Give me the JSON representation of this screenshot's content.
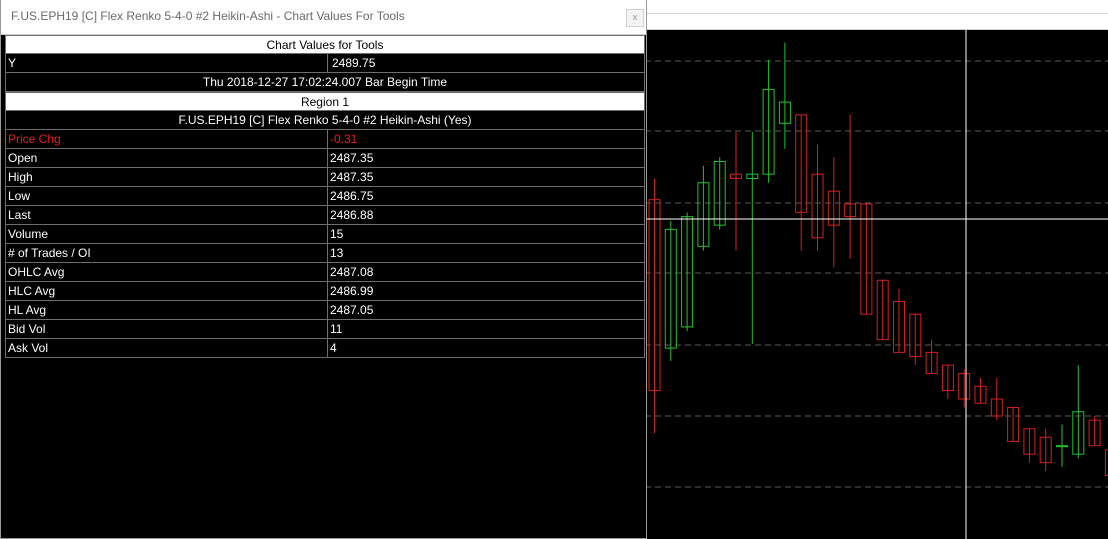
{
  "window": {
    "title": "F.US.EPH19 [C]  Flex Renko 5-4-0  #2 Heikin-Ashi - Chart Values For Tools",
    "close_glyph": "x"
  },
  "table": {
    "header": "Chart Values for Tools",
    "y_row": {
      "label": "Y",
      "value": "2489.75"
    },
    "bar_time": "Thu 2018-12-27  17:02:24.007  Bar Begin Time",
    "region": "Region 1",
    "study": "F.US.EPH19 [C]  Flex Renko 5-4-0  #2 Heikin-Ashi (Yes)",
    "rows": [
      {
        "label": "Price Chg",
        "value": "-0.31",
        "color": "#e81e1e"
      },
      {
        "label": "Open",
        "value": "2487.35"
      },
      {
        "label": "High",
        "value": "2487.35"
      },
      {
        "label": "Low",
        "value": "2486.75"
      },
      {
        "label": "Last",
        "value": "2486.88"
      },
      {
        "label": "Volume",
        "value": "15"
      },
      {
        "label": "# of Trades / OI",
        "value": "13"
      },
      {
        "label": "OHLC Avg",
        "value": "2487.08"
      },
      {
        "label": "HLC Avg",
        "value": "2486.99"
      },
      {
        "label": "HL Avg",
        "value": "2487.05"
      },
      {
        "label": "Bid Vol",
        "value": "11"
      },
      {
        "label": "Ask Vol",
        "value": "4"
      }
    ]
  },
  "colors": {
    "up": "#22c22a",
    "down": "#d42020",
    "crosshair": "#ffffff",
    "grid": "#5a5a5a",
    "background": "#000000"
  },
  "chart": {
    "candles": [
      {
        "dir": "down",
        "open": 2491.0,
        "close": 2486.5,
        "high": 2491.5,
        "low": 2485.5
      },
      {
        "dir": "up",
        "open": 2487.5,
        "close": 2490.3,
        "high": 2490.5,
        "low": 2487.2
      },
      {
        "dir": "up",
        "open": 2488.0,
        "close": 2490.6,
        "high": 2490.7,
        "low": 2487.9
      },
      {
        "dir": "up",
        "open": 2489.9,
        "close": 2491.4,
        "high": 2491.8,
        "low": 2489.8
      },
      {
        "dir": "up",
        "open": 2490.4,
        "close": 2491.9,
        "high": 2492.0,
        "low": 2490.3
      },
      {
        "dir": "down",
        "open": 2491.6,
        "close": 2491.5,
        "high": 2492.6,
        "low": 2489.8
      },
      {
        "dir": "up",
        "open": 2491.5,
        "close": 2491.6,
        "high": 2492.6,
        "low": 2487.6
      },
      {
        "dir": "up",
        "open": 2491.6,
        "close": 2493.6,
        "high": 2494.3,
        "low": 2491.4
      },
      {
        "dir": "up",
        "open": 2492.8,
        "close": 2493.3,
        "high": 2494.7,
        "low": 2492.2
      },
      {
        "dir": "down",
        "open": 2493.0,
        "close": 2490.7,
        "high": 2493.0,
        "low": 2489.8
      },
      {
        "dir": "down",
        "open": 2491.6,
        "close": 2490.1,
        "high": 2492.3,
        "low": 2489.8
      },
      {
        "dir": "down",
        "open": 2491.2,
        "close": 2490.4,
        "high": 2492.0,
        "low": 2489.4
      },
      {
        "dir": "down",
        "open": 2490.9,
        "close": 2490.6,
        "high": 2493.0,
        "low": 2489.6
      },
      {
        "dir": "down",
        "open": 2490.9,
        "close": 2488.3,
        "high": 2490.9,
        "low": 2488.3
      },
      {
        "dir": "down",
        "open": 2489.1,
        "close": 2487.7,
        "high": 2489.1,
        "low": 2487.7
      },
      {
        "dir": "down",
        "open": 2488.6,
        "close": 2487.4,
        "high": 2488.9,
        "low": 2487.4
      },
      {
        "dir": "down",
        "open": 2488.3,
        "close": 2487.3,
        "high": 2488.3,
        "low": 2487.1
      },
      {
        "dir": "down",
        "open": 2487.4,
        "close": 2486.9,
        "high": 2487.7,
        "low": 2486.9
      },
      {
        "dir": "down",
        "open": 2487.1,
        "close": 2486.5,
        "high": 2487.1,
        "low": 2486.3
      },
      {
        "dir": "down",
        "open": 2486.9,
        "close": 2486.3,
        "high": 2487.0,
        "low": 2486.1
      },
      {
        "dir": "down",
        "open": 2486.6,
        "close": 2486.2,
        "high": 2486.8,
        "low": 2486.2
      },
      {
        "dir": "down",
        "open": 2486.3,
        "close": 2485.9,
        "high": 2486.8,
        "low": 2485.8
      },
      {
        "dir": "down",
        "open": 2486.1,
        "close": 2485.3,
        "high": 2486.1,
        "low": 2485.3
      },
      {
        "dir": "down",
        "open": 2485.6,
        "close": 2485.0,
        "high": 2485.6,
        "low": 2484.8
      },
      {
        "dir": "down",
        "open": 2485.4,
        "close": 2484.8,
        "high": 2485.6,
        "low": 2484.6
      },
      {
        "dir": "up",
        "open": 2485.2,
        "close": 2485.2,
        "high": 2485.7,
        "low": 2484.7
      },
      {
        "dir": "up",
        "open": 2485.0,
        "close": 2486.0,
        "high": 2487.1,
        "low": 2484.9
      },
      {
        "dir": "down",
        "open": 2485.8,
        "close": 2485.2,
        "high": 2485.9,
        "low": 2485.2
      },
      {
        "dir": "down",
        "open": 2485.1,
        "close": 2484.5,
        "high": 2485.6,
        "low": 2484.3
      }
    ]
  }
}
